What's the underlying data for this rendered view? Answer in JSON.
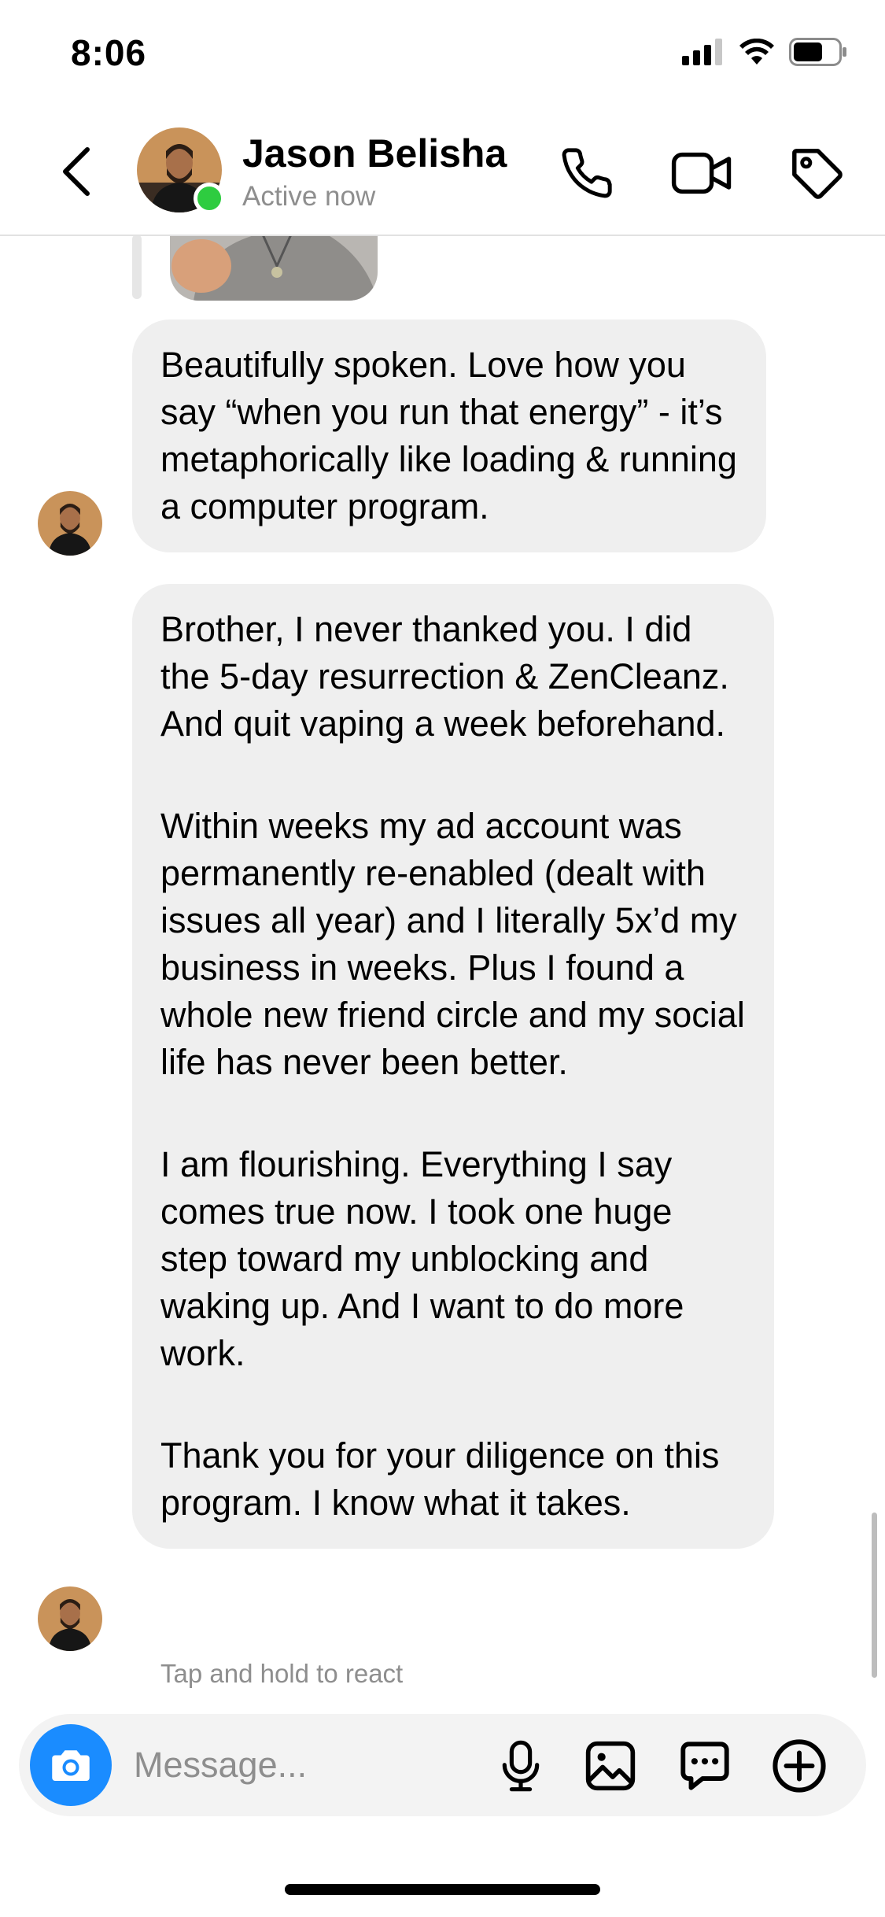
{
  "status_bar": {
    "time": "8:06",
    "battery_level": 0.65
  },
  "header": {
    "contact_name": "Jason Belisha",
    "contact_status": "Active now"
  },
  "messages": [
    {
      "sender": "contact",
      "text": [
        "Beautifully spoken. Love how you say “when you run that energy” - it’s metaphorically like loading & running a computer program."
      ]
    },
    {
      "sender": "contact",
      "text": [
        "Brother, I never thanked you. I did the 5-day resurrection & ZenCleanz. And quit vaping a week beforehand.",
        "Within weeks my ad account was permanently re-enabled (dealt with issues all year) and I literally 5x’d my business in weeks. Plus I found a whole new friend circle and my social life has never been better.",
        "I am flourishing. Everything I say comes true now. I took one huge step toward my unblocking and waking up. And I want to do more work.",
        "Thank you for your diligence on this program. I know what it takes."
      ]
    }
  ],
  "react_hint": "Tap and hold to react",
  "composer": {
    "placeholder": "Message..."
  },
  "colors": {
    "accent_blue": "#1a8cff",
    "active_green": "#2ecc40",
    "bubble_gray": "#efefef"
  },
  "icons": [
    "back-icon",
    "phone-icon",
    "video-camera-icon",
    "tag-icon",
    "camera-icon",
    "microphone-icon",
    "image-icon",
    "sticker-chat-icon",
    "plus-icon"
  ]
}
